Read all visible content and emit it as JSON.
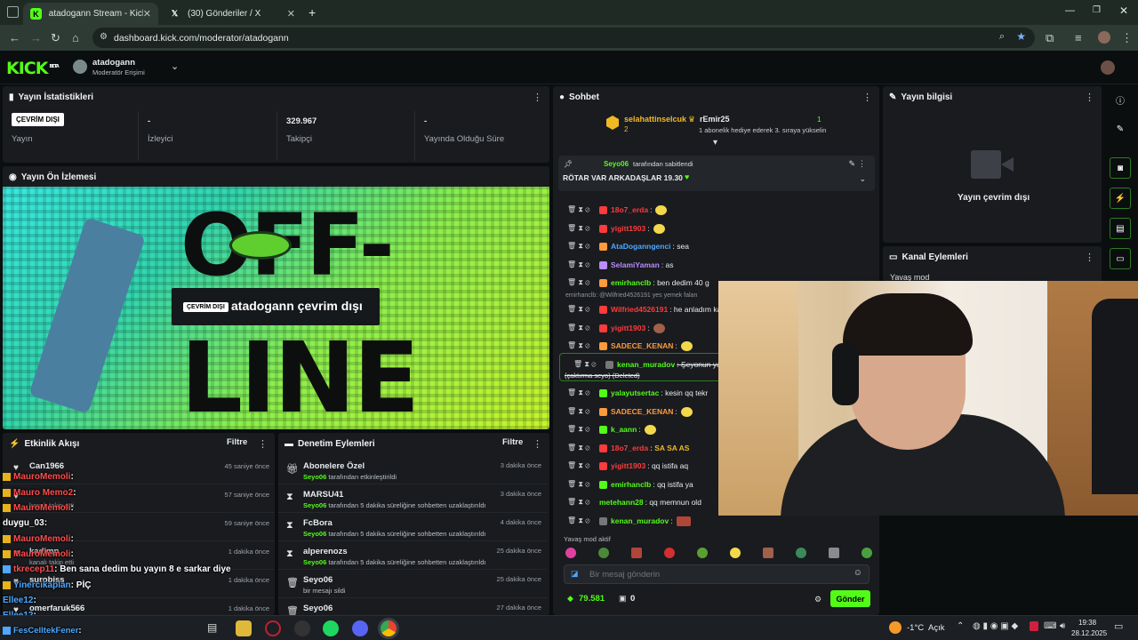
{
  "browser": {
    "tabs": [
      {
        "title": "atadogann Stream - Kick Dashb",
        "active": true
      },
      {
        "title": "(30) Gönderiler / X",
        "active": false
      }
    ],
    "url": "dashboard.kick.com/moderator/atadogann"
  },
  "header": {
    "logo": "KICK",
    "logo_tag": "BETA",
    "channel_name": "atadogann",
    "channel_role": "Moderatör Erişimi"
  },
  "stats_panel": {
    "title": "Yayın İstatistikleri",
    "items": [
      {
        "value": "ÇEVRİM DIŞI",
        "label": "Yayın"
      },
      {
        "value": "-",
        "label": "İzleyici"
      },
      {
        "value": "329.967",
        "label": "Takipçi"
      },
      {
        "value": "-",
        "label": "Yayında Olduğu Süre"
      }
    ]
  },
  "preview_panel": {
    "title": "Yayın Ön İzlemesi",
    "offline_badge": "ÇEVRİM DIŞI",
    "offline_text": "atadogann çevrim dışı",
    "art_text_1": "OFF-",
    "art_text_2": "LINE"
  },
  "activity_panel": {
    "title": "Etkinlik Akışı",
    "filter": "Filtre",
    "rows": [
      {
        "name": "Can1966",
        "sub": "",
        "time": "45 saniye önce"
      },
      {
        "name": "",
        "sub": "kanalı takip etti",
        "time": "57 saniye önce"
      },
      {
        "name": "",
        "sub": "",
        "time": "59 saniye önce"
      },
      {
        "name": "kadimp",
        "sub": "kanalı takip etti",
        "time": "1 dakika önce"
      },
      {
        "name": "surobiss",
        "sub": "",
        "time": "1 dakika önce"
      },
      {
        "name": "omerfaruk566",
        "sub": "",
        "time": "1 dakika önce"
      }
    ]
  },
  "mod_panel": {
    "title": "Denetim Eylemleri",
    "filter": "Filtre",
    "rows": [
      {
        "name": "Abonelere Özel",
        "actor": "Seyo06",
        "sub": "tarafından etkinleştirildi",
        "time": "3 dakika önce",
        "icon": "gift-icon"
      },
      {
        "name": "MARSU41",
        "actor": "Seyo06",
        "sub": "tarafından 5 dakika süreliğine sohbetten uzaklaştırıldı",
        "time": "3 dakika önce",
        "icon": "hourglass-icon"
      },
      {
        "name": "FcBora",
        "actor": "Seyo06",
        "sub": "tarafından 5 dakika süreliğine sohbetten uzaklaştırıldı",
        "time": "4 dakika önce",
        "icon": "hourglass-icon"
      },
      {
        "name": "alperenozs",
        "actor": "Seyo06",
        "sub": "tarafından 5 dakika süreliğine sohbetten uzaklaştırıldı",
        "time": "25 dakika önce",
        "icon": "hourglass-icon"
      },
      {
        "name": "Seyo06",
        "actor": "",
        "sub": "bir mesajı sildi",
        "time": "25 dakika önce",
        "icon": "trash-icon"
      },
      {
        "name": "Seyo06",
        "actor": "",
        "sub": "",
        "time": "27 dakika önce",
        "icon": "trash-icon"
      }
    ]
  },
  "chat_panel": {
    "title": "Sohbet",
    "top_gifter": {
      "name": "selahattinselcuk",
      "count": "2"
    },
    "gift_event": {
      "name": "rEmir25",
      "text": "1 abonelik hediye ederek 3. sıraya yükselin",
      "count": "1"
    },
    "pinned": {
      "by": "Seyo06",
      "by_text": "tarafından sabitlendi",
      "message": "RÖTAR VAR ARKADAŞLAR 19.30"
    },
    "reply_preview": "emirhanclb: @Wilfried4526191 yes yemek falan",
    "messages": [
      {
        "user": "18o7_erda",
        "color": "#ff3b3b",
        "text": ":",
        "emote": true
      },
      {
        "user": "yigitt1903",
        "color": "#ff3b3b",
        "text": ":",
        "emote": true
      },
      {
        "user": "AtaDoganngenci",
        "color": "#4ea8ff",
        "text": ": sea",
        "emote": false
      },
      {
        "user": "SelamiYaman",
        "color": "#b98cff",
        "text": ": as",
        "emote": false
      },
      {
        "user": "emirhanclb",
        "color": "#53fc18",
        "text": ": ben dedim 40 g",
        "emote": false
      },
      {
        "user": "Wilfried4526191",
        "color": "#ff3b3b",
        "text": ": he anladım ka",
        "emote": false
      },
      {
        "user": "yigitt1903",
        "color": "#ff3b3b",
        "text": ":",
        "emote": true
      },
      {
        "user": "SADECE_KENAN",
        "color": "#ff9b3b",
        "text": ":",
        "emote": true
      },
      {
        "user": "kenan_muradov",
        "color": "#53fc18",
        "text": ": Şeyonun yaye",
        "emote": false
      },
      {
        "user": "yalayutsertac",
        "color": "#53fc18",
        "text": ": kesin qq tekr",
        "emote": false
      },
      {
        "user": "SADECE_KENAN",
        "color": "#ff9b3b",
        "text": ":",
        "emote": true
      },
      {
        "user": "k_aann",
        "color": "#53fc18",
        "text": ":",
        "emote": true
      },
      {
        "user": "18o7_erda",
        "color": "#ff3b3b",
        "text": ": SA SA AS",
        "emote": false
      },
      {
        "user": "yigitt1903",
        "color": "#ff3b3b",
        "text": ": qq istifa aq",
        "emote": false
      },
      {
        "user": "emirhanclb",
        "color": "#53fc18",
        "text": ": qq istifa ya",
        "emote": false
      },
      {
        "user": "metehann28",
        "color": "#53fc18",
        "text": ": qq memnun old",
        "emote": false
      },
      {
        "user": "kenan_muradov",
        "color": "#53fc18",
        "text": ":",
        "emote": true
      }
    ],
    "deleted_note": "(çaktırma seyo) (Deleted)",
    "slow_mode": "Yavaş mod aktif",
    "input_placeholder": "Bir mesaj gönderin",
    "points": "79.581",
    "chest": "0",
    "send_button": "Gönder"
  },
  "stream_info_panel": {
    "title": "Yayın bilgisi",
    "offline_text": "Yayın çevrim dışı"
  },
  "channel_actions_panel": {
    "title": "Kanal Eylemleri",
    "first_item": "Yavaş mod"
  },
  "overlay_chat": [
    {
      "user": "MauroMemoli",
      "text": ":",
      "color": "#ff4d4d"
    },
    {
      "user": "Mauro Memo2",
      "text": ":",
      "color": "#ff4d4d"
    },
    {
      "user": "MauroMemoli",
      "text": ":",
      "color": "#ff4d4d"
    },
    {
      "user": "duygu_03",
      "text": ":",
      "color": "#ffffff"
    },
    {
      "user": "MauroMemoli",
      "text": ":",
      "color": "#ff4d4d"
    },
    {
      "user": "MauroMemoli",
      "text": ":",
      "color": "#ff4d4d"
    },
    {
      "user": "tkrecep11",
      "text": ": Ben sana dedim bu yayın 8 e sarkar diye",
      "color": "#ff4d4d"
    },
    {
      "user": "Yinercikaplan",
      "text": ": PİÇ",
      "color": "#4ea8ff"
    },
    {
      "user": "Ellee12",
      "text": ":",
      "color": "#4ea8ff"
    },
    {
      "user": "Ellee12",
      "text": ":",
      "color": "#4ea8ff"
    },
    {
      "user": "FesCelltekFener",
      "text": ":",
      "color": "#4ea8ff"
    }
  ],
  "taskbar": {
    "weather": "-1°C",
    "weather_desc": "Açık",
    "time": "19:38",
    "date": "28.12.2025"
  },
  "colors": {
    "accent": "#53fc18",
    "panel": "#191b1f",
    "bg": "#0b0e0f"
  }
}
